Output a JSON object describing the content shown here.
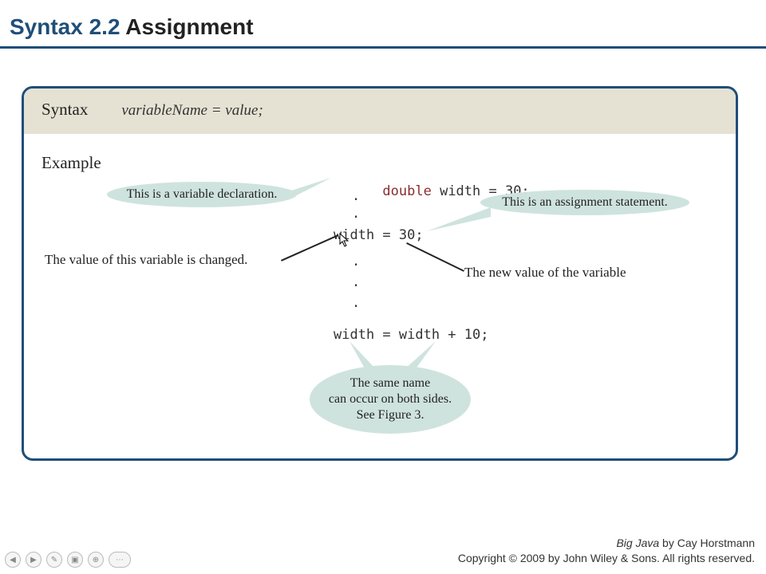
{
  "header": {
    "blue": "Syntax 2.2",
    "black": " Assignment"
  },
  "syntax": {
    "label": "Syntax",
    "code": "variableName = value;"
  },
  "example": {
    "label": "Example",
    "line1_kw": "double",
    "line1_rest": " width = 30;",
    "line2": "width = 30;",
    "line3": "width = width + 10;"
  },
  "callouts": {
    "decl": "This is a variable declaration.",
    "assign": "This is an assignment statement.",
    "changed": "The value of this variable is changed.",
    "newval": "The new value of the variable",
    "samename_l1": "The same name",
    "samename_l2": "can occur on both sides.",
    "samename_l3": "See Figure 3."
  },
  "footer": {
    "line1_book": "Big Java",
    "line1_rest": " by Cay Horstmann",
    "line2": "Copyright © 2009 by John Wiley & Sons.  All rights reserved."
  },
  "nav": {
    "prev": "◀",
    "next": "▶",
    "pen": "✎",
    "screen": "▣",
    "zoom": "⊕",
    "more": "⋯"
  }
}
